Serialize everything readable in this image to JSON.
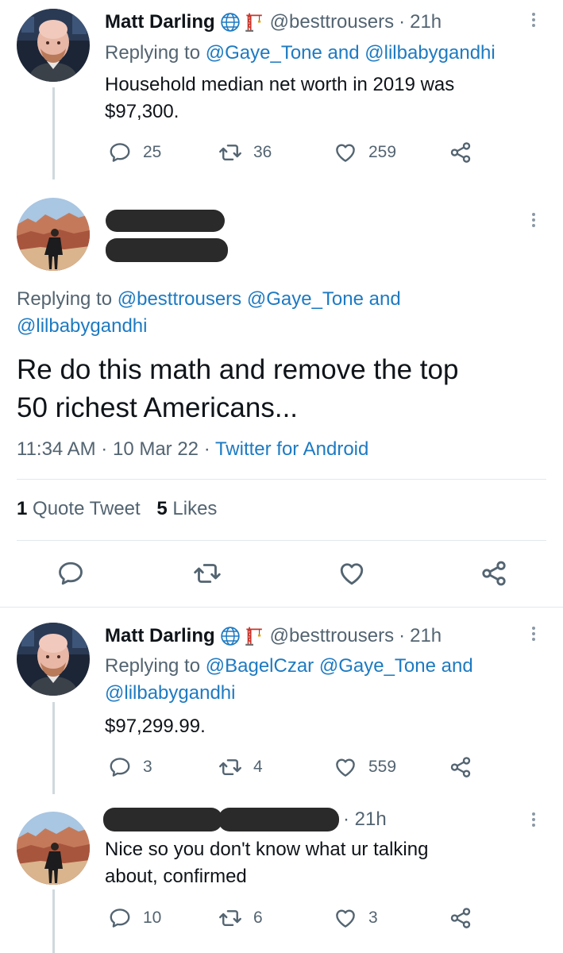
{
  "tweet1": {
    "name": "Matt Darling",
    "handle": "@besttrousers",
    "sep": "·",
    "time": "21h",
    "replying_prefix": "Replying to",
    "reply_mentions": [
      "@Gaye_Tone",
      "and",
      "@lilbabygandhi"
    ],
    "text_line1": "Household median net worth in 2019 was",
    "text_line2": "$97,300.",
    "replies": "25",
    "retweets": "36",
    "likes": "259"
  },
  "main_tweet": {
    "replying_prefix": "Replying to",
    "mentions_line1": [
      "@besttrousers",
      "@Gaye_Tone",
      "and"
    ],
    "mentions_line2": "@lilbabygandhi",
    "text_line1": "Re do this math and remove the top",
    "text_line2": "50 richest Americans...",
    "time": "11:34 AM",
    "sep1": "·",
    "date": "10 Mar 22",
    "sep2": "·",
    "client": "Twitter for Android",
    "quote_count": "1",
    "quote_label": "Quote Tweet",
    "likes_count": "5",
    "likes_label": "Likes"
  },
  "tweet3": {
    "name": "Matt Darling",
    "handle": "@besttrousers",
    "sep": "·",
    "time": "21h",
    "replying_prefix": "Replying to",
    "mentions_line1": [
      "@BagelCzar",
      "@Gaye_Tone",
      "and"
    ],
    "mentions_line2": "@lilbabygandhi",
    "text": "$97,299.99.",
    "replies": "3",
    "retweets": "4",
    "likes": "559"
  },
  "tweet4": {
    "time": "· 21h",
    "text_line1": "Nice so you don't know what ur talking",
    "text_line2": "about, confirmed",
    "replies": "10",
    "retweets": "6",
    "likes": "3"
  },
  "icons": {
    "reply": "reply-icon",
    "retweet": "retweet-icon",
    "like": "heart-icon",
    "share": "share-icon",
    "more": "more-icon",
    "globe": "globe-icon",
    "crane": "crane-icon"
  },
  "colors": {
    "link": "#1d7ac2",
    "muted": "#536471",
    "text": "#0f1419",
    "thread_line": "#cfd9de"
  }
}
